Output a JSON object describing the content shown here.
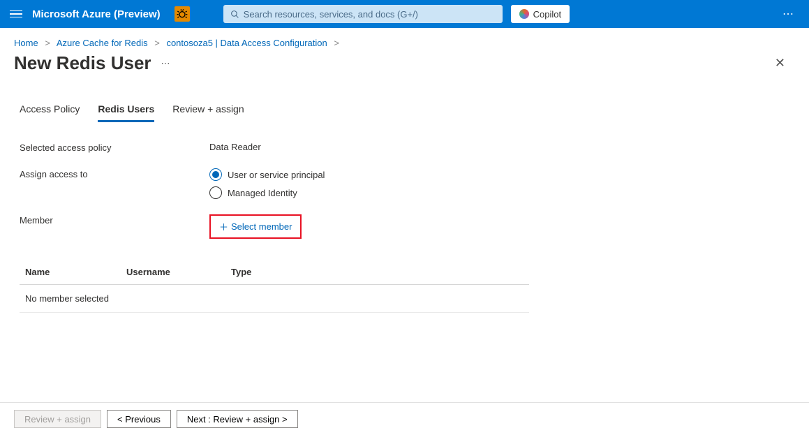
{
  "header": {
    "brand": "Microsoft Azure (Preview)",
    "search_placeholder": "Search resources, services, and docs (G+/)",
    "copilot_label": "Copilot"
  },
  "breadcrumb": [
    {
      "label": "Home"
    },
    {
      "label": "Azure Cache for Redis"
    },
    {
      "label": "contosoza5 | Data Access Configuration"
    }
  ],
  "page": {
    "title": "New Redis User"
  },
  "tabs": [
    {
      "label": "Access Policy",
      "active": false
    },
    {
      "label": "Redis Users",
      "active": true
    },
    {
      "label": "Review + assign",
      "active": false
    }
  ],
  "form": {
    "selected_policy_label": "Selected access policy",
    "selected_policy_value": "Data Reader",
    "assign_label": "Assign access to",
    "radio_user": "User or service principal",
    "radio_managed": "Managed Identity",
    "member_label": "Member",
    "select_member_label": "Select member"
  },
  "table": {
    "columns": {
      "name": "Name",
      "username": "Username",
      "type": "Type"
    },
    "empty_text": "No member selected"
  },
  "footer": {
    "review": "Review + assign",
    "previous": "< Previous",
    "next": "Next : Review + assign >"
  }
}
